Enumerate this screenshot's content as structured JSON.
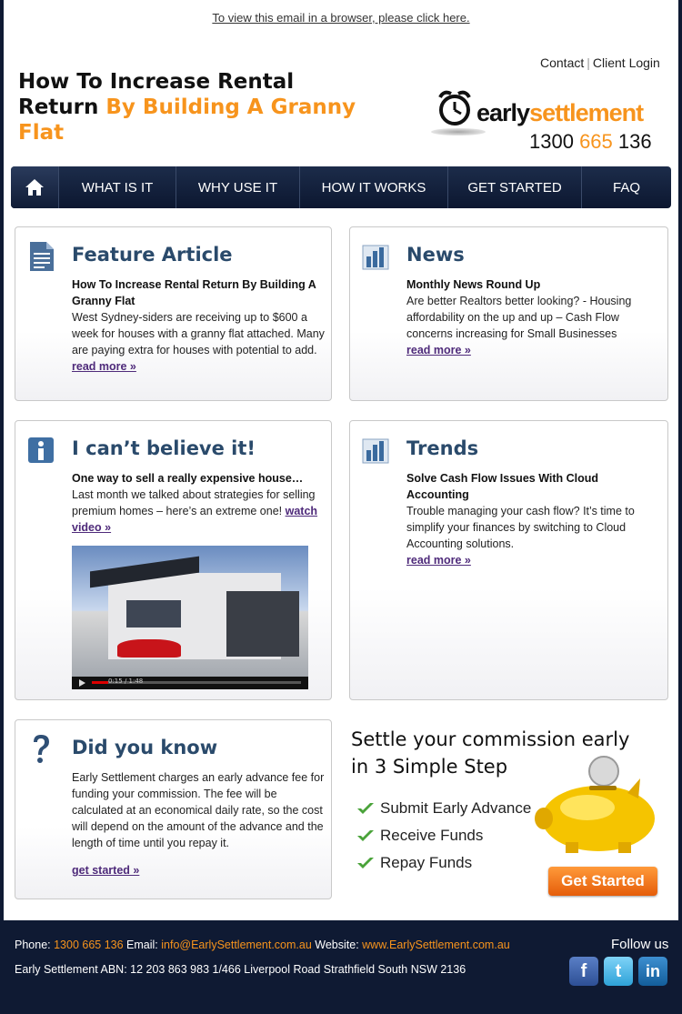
{
  "header": {
    "view_in_browser": "To view this email in a browser, please click here.",
    "title_line1": "How To Increase Rental",
    "title_line2_plain": "Return ",
    "title_line2_accent": "By Building A Granny",
    "title_line3_accent": "Flat",
    "contact_label": "Contact",
    "separator": "|",
    "client_login_label": "Client Login"
  },
  "logo": {
    "brand_dark": "early",
    "brand_accent": "settlement",
    "phone_start": "1300 ",
    "phone_mid": "665",
    "phone_end": " 136"
  },
  "nav": {
    "items": [
      {
        "label": "WHAT IS IT"
      },
      {
        "label": "WHY USE IT"
      },
      {
        "label": "HOW IT WORKS"
      },
      {
        "label": "GET STARTED"
      },
      {
        "label": "FAQ"
      }
    ]
  },
  "panels": {
    "feature": {
      "title": "Feature Article",
      "subtitle": "How To Increase Rental Return By Building A Granny Flat",
      "text": "West Sydney-siders are receiving up to $600 a week for houses with a granny flat attached. Many are paying extra for houses with potential to add.",
      "more": "read more »"
    },
    "news": {
      "title": "News",
      "subtitle": "Monthly News Round Up",
      "text": "Are better Realtors better looking? - Housing affordability on the up and up – Cash Flow concerns increasing for Small Businesses",
      "more": "read more »"
    },
    "believe": {
      "title": "I can’t believe it!",
      "subtitle": "One way to sell a really expensive house…",
      "text": "Last month we talked about strategies for selling premium homes – here’s an extreme one! ",
      "video_link": "watch video »",
      "video_time": "0:15 / 1:48"
    },
    "trends": {
      "title": "Trends",
      "subtitle": "Solve Cash Flow Issues With Cloud Accounting",
      "text": "Trouble managing your cash flow?  It’s time to simplify your finances by switching to Cloud Accounting solutions.",
      "more": "read more »"
    },
    "know": {
      "title": "Did you know",
      "text": "Early Settlement charges an early advance fee for funding your commission. The fee will be calculated at an economical daily rate, so the cost will depend on the amount of the advance and the length of time until you repay it.",
      "more": "get started »"
    }
  },
  "promo": {
    "headline_line1": "Settle your commission early",
    "headline_line2": "in 3 Simple Step",
    "steps": [
      {
        "label": "Submit Early Advance"
      },
      {
        "label": "Receive Funds"
      },
      {
        "label": "Repay Funds"
      }
    ],
    "cta": "Get Started"
  },
  "footer": {
    "phone_label": "Phone: ",
    "phone": "1300 665 136",
    "email_label": " Email: ",
    "email": "info@EarlySettlement.com.au",
    "website_label": " Website: ",
    "website": "www.EarlySettlement.com.au",
    "abn_line": "Early Settlement ABN: 12 203 863 983    1/466 Liverpool Road Strathfield South NSW 2136",
    "follow": "Follow us",
    "facebook_glyph": "f",
    "twitter_glyph": "t",
    "linkedin_glyph": "in"
  },
  "colors": {
    "accent": "#f7941d",
    "navy": "#0f1a33",
    "heading": "#2a4a6b",
    "link": "#4e2a7a"
  },
  "icons": {
    "nav_home": "home-icon",
    "feature": "document-icon",
    "news": "bar-chart-icon",
    "believe": "info-icon",
    "trends": "bar-chart-icon",
    "know": "question-icon",
    "step": "check-icon",
    "pig": "piggy-bank-icon"
  }
}
